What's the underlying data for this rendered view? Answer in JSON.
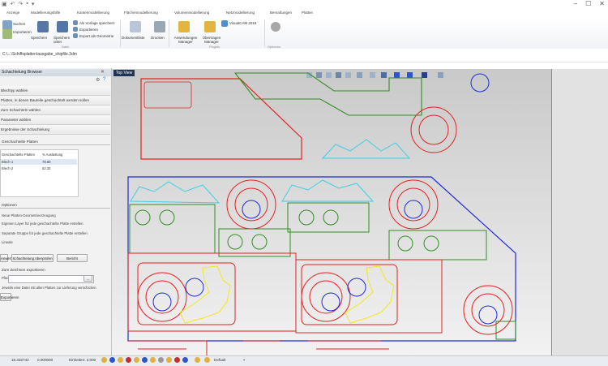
{
  "menu": [
    "Anzeige",
    "Modellierungshilfe",
    "Kantenmodellierung",
    "Flächenmodellierung",
    "Volumenmodellierung",
    "Netzmodellierung",
    "Bemaßungen",
    "Platten"
  ],
  "ribbon": {
    "buttons": [
      "Suchen",
      "Importieren",
      "Speichern",
      "Speichern unter",
      "Als Vorlage speichern",
      "Exportieren",
      "Export als Geometrie",
      "Dokumentliste",
      "Drucken",
      "Anwendungen Manager",
      "Übertragen Manager",
      "VisualCAM 2018"
    ],
    "groups": [
      "Datei",
      "Plugins",
      "Optionen"
    ]
  },
  "path": "C:\\...\\Schiffsplatten\\ausgabe_shipfile.3dm",
  "panel": {
    "title": "Schachtelung Browser",
    "steps": [
      "Blechtyp wählen",
      "Platten, in denen Bauteile geschachtelt werden sollen",
      "Zum Schachteln wählen",
      "Parameter wählen",
      "Ergebnisse der Schachtelung"
    ],
    "plates_label": "Geschachtelte Platten",
    "table_headers": [
      "Geschachtelte Platten",
      "% Auslastung"
    ],
    "table_rows": [
      [
        "Blech-1",
        "78.60"
      ],
      [
        "Blech-2",
        "52.33"
      ]
    ],
    "options_label": "Optionen",
    "checkboxes": [
      "Neue Platten-Geometrieerzeugung",
      "Eigenen Layer für jede geschachtelte Platte erstellen",
      "Separate Gruppe für jede geschachtelte Platte erstellen",
      "Lineale"
    ],
    "buttons": [
      "Anwenden",
      "Schachtelung überprüfen",
      "Bericht"
    ],
    "export_label": "Zum Zeichnen exportieren",
    "pfad_label": "Pfad",
    "browse": "...",
    "export_cb": "Jeweils eine Datei mit allen Platten zur Lieferung verschicken",
    "export_btn": "Exportieren"
  },
  "view": {
    "label": "Top View",
    "colors": {
      "blue": "#1f2bd6",
      "red": "#e62020",
      "green": "#2f8f1f",
      "cyan": "#3fcfe0",
      "yellow": "#f2e81a"
    }
  },
  "status": {
    "x": "16.332742",
    "y": "0.000000",
    "unit": "Einheiten: 2.000",
    "layer": "Default"
  }
}
